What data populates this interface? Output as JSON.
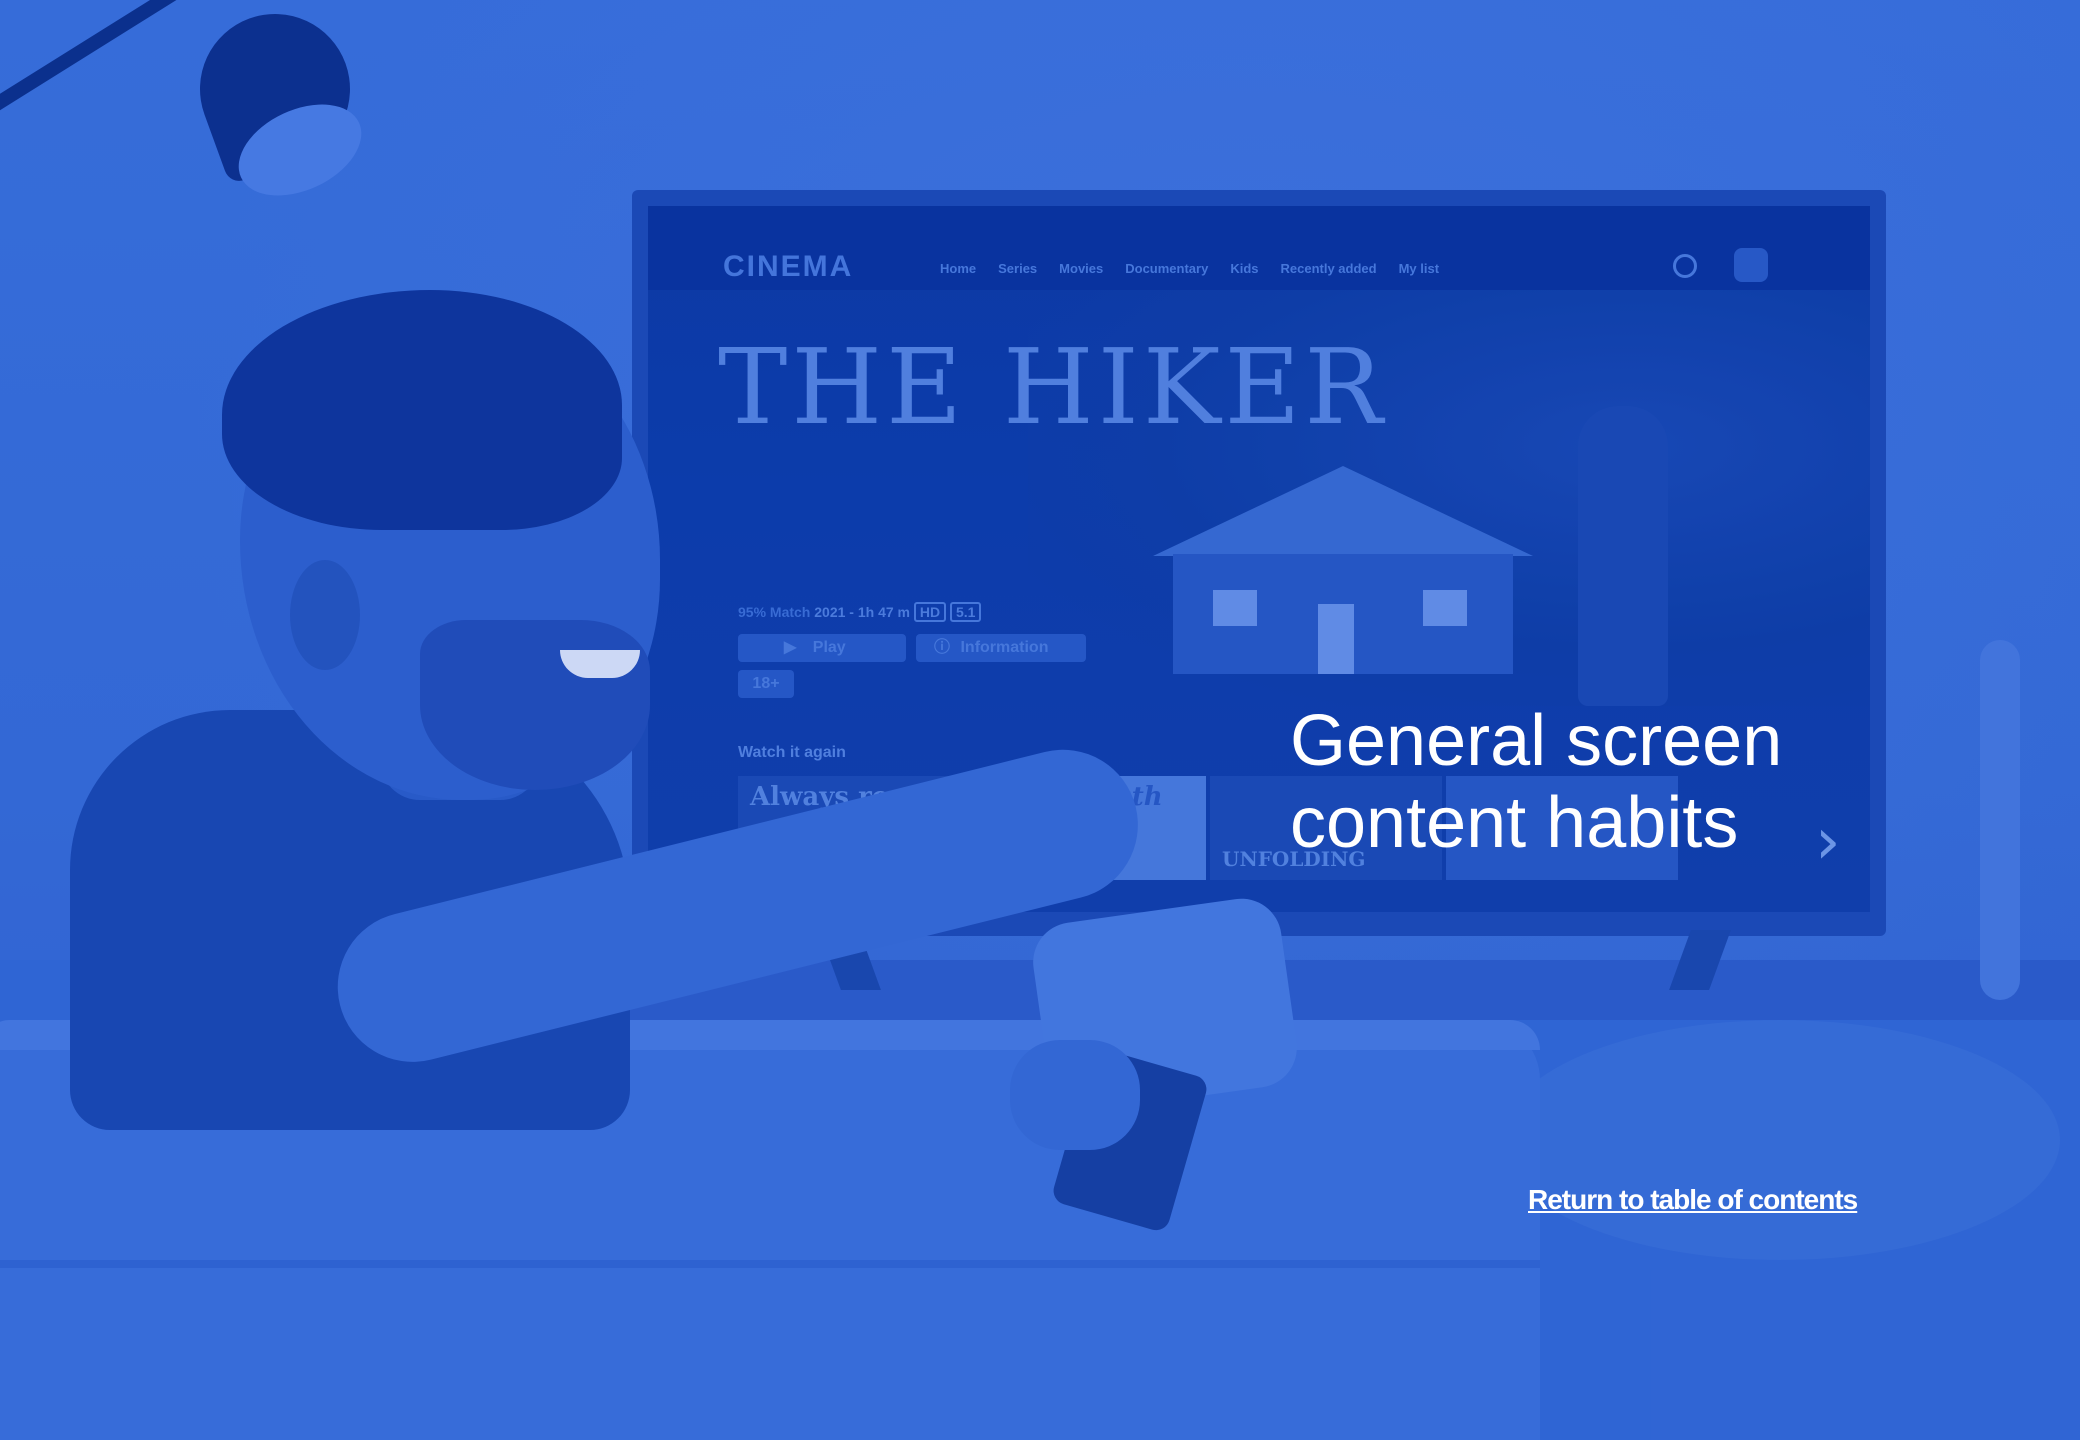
{
  "slide": {
    "heading_line1": "General screen",
    "heading_line2": "content habits",
    "return_link": "Return to table of contents"
  },
  "tv_ui": {
    "logo": "CINEMA",
    "nav": [
      "Home",
      "Series",
      "Movies",
      "Documentary",
      "Kids",
      "Recently added",
      "My list"
    ],
    "featured_title": "THE HIKER",
    "match": "95% Match",
    "year": "2021 -",
    "duration": "1h 47 m",
    "badges": [
      "HD",
      "5.1"
    ],
    "play_label": "Play",
    "info_label": "Information",
    "rating": "18+",
    "row_label": "Watch it again",
    "tiles": [
      "Always road",
      "to the south",
      "UNFOLDING",
      ""
    ]
  },
  "colors": {
    "background": "#3a70d6",
    "text": "#ffffff"
  },
  "icons": [
    "search-icon",
    "profile-icon",
    "play-icon",
    "info-icon",
    "chevron-right-icon"
  ]
}
